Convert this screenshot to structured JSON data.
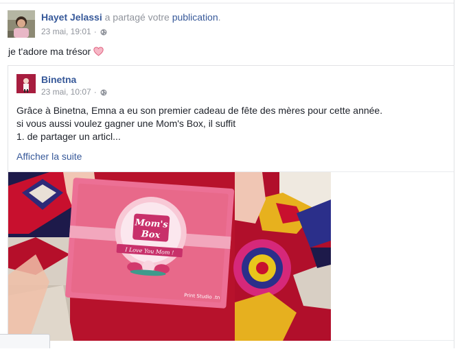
{
  "outer_post": {
    "author": "Hayet Jelassi",
    "action": "a partagé votre",
    "target": "publication",
    "period": ".",
    "timestamp": "23 mai, 19:01",
    "dot": "·",
    "message": "je t'adore ma trésor",
    "emoji": "heart-emoji"
  },
  "shared_post": {
    "author": "Binetna",
    "timestamp": "23 mai, 10:07",
    "dot": "·",
    "lines": [
      "Grâce à Binetna, Emna a eu son premier cadeau de fête des mères pour cette année.",
      "si vous aussi voulez gagner une Mom's Box, il suffit",
      "1. de partager un articl..."
    ],
    "see_more": "Afficher la suite"
  },
  "photo": {
    "box_title_line1": "Mom's",
    "box_title_line2": "Box",
    "ribbon": "I Love You Mom !",
    "credit": "Print Studio .tn"
  },
  "colors": {
    "link": "#365899",
    "meta": "#90949c",
    "box_pink": "#e8698a",
    "rug_red": "#c8102e"
  },
  "icons": [
    "globe-icon",
    "heart-emoji"
  ]
}
